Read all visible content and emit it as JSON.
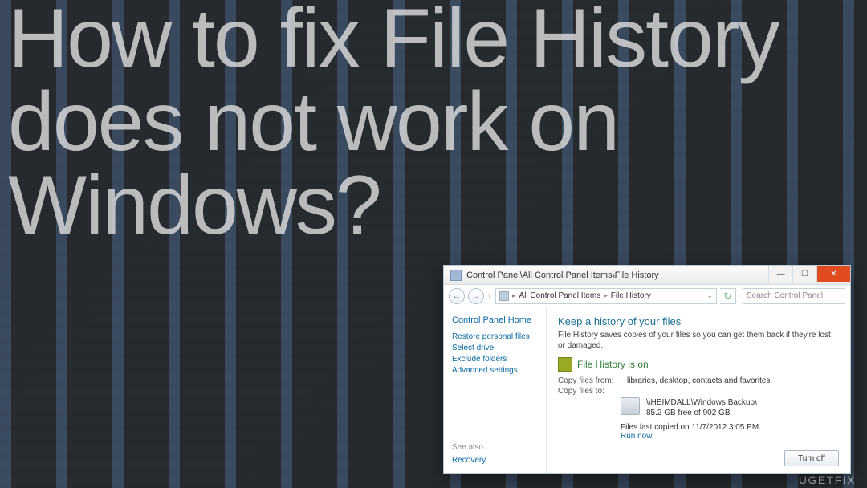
{
  "headline": "How to fix File History does not work on Windows?",
  "watermark": "UGETFIX",
  "window": {
    "title": "Control Panel\\All Control Panel Items\\File History",
    "breadcrumb": {
      "level1": "All Control Panel Items",
      "level2": "File History"
    },
    "search_placeholder": "Search Control Panel",
    "sidebar": {
      "home": "Control Panel Home",
      "links": {
        "restore": "Restore personal files",
        "select": "Select drive",
        "exclude": "Exclude folders",
        "advanced": "Advanced settings"
      },
      "see_also_label": "See also",
      "see_also": {
        "recovery": "Recovery"
      }
    },
    "content": {
      "heading": "Keep a history of your files",
      "description": "File History saves copies of your files so you can get them back if they're lost or damaged.",
      "status": "File History is on",
      "copy_from_label": "Copy files from:",
      "copy_from_value": "libraries, desktop, contacts and favorites",
      "copy_to_label": "Copy files to:",
      "drive_path": "\\\\HEIMDALL\\Windows Backup\\",
      "drive_free": "85.2 GB free of 902 GB",
      "last_copied": "Files last copied on 11/7/2012 3:05 PM.",
      "run_now": "Run now",
      "turn_off": "Turn off"
    }
  }
}
